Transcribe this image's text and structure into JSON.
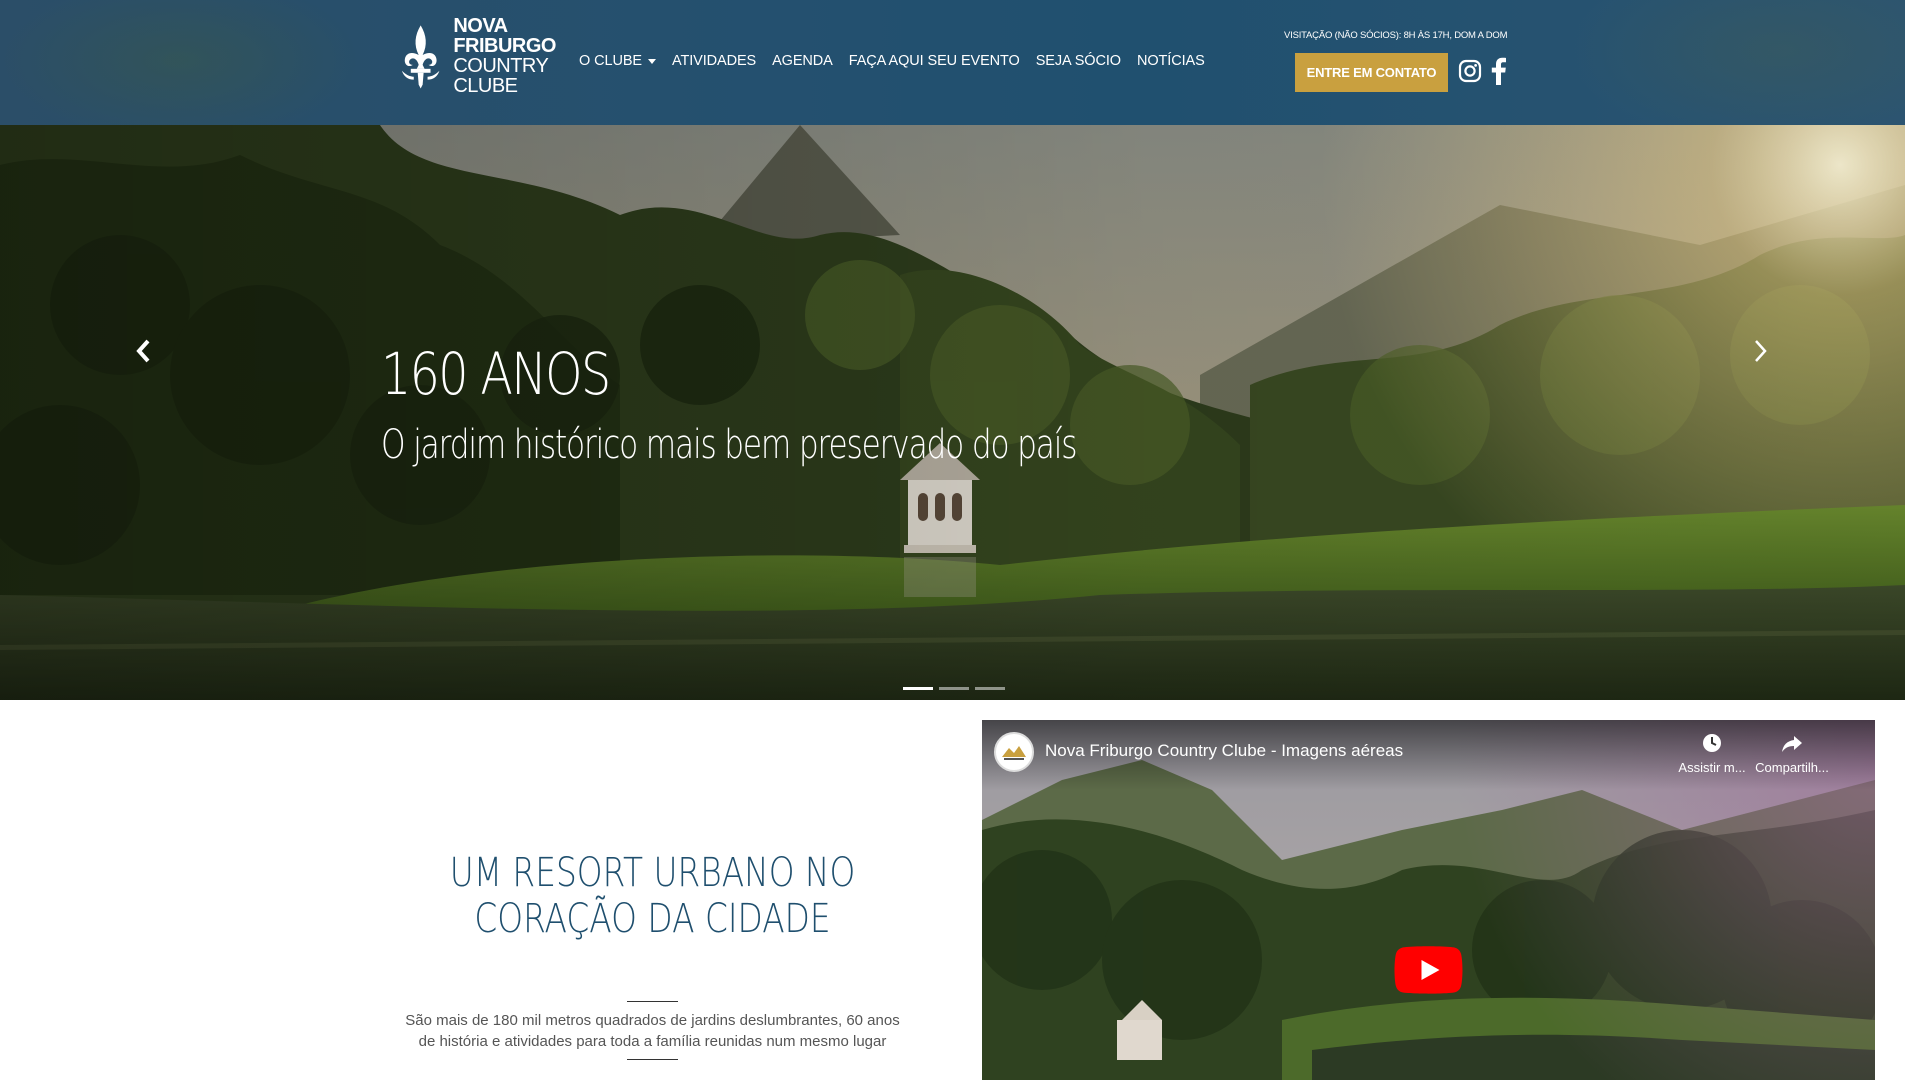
{
  "header": {
    "logo": {
      "line1": "NOVA",
      "line2": "FRIBURGO",
      "line3": "COUNTRY",
      "line4": "CLUBE"
    },
    "nav": [
      {
        "label": "O CLUBE",
        "dropdown": true
      },
      {
        "label": "ATIVIDADES"
      },
      {
        "label": "AGENDA"
      },
      {
        "label": "FAÇA AQUI SEU EVENTO"
      },
      {
        "label": "SEJA SÓCIO"
      },
      {
        "label": "NOTÍCIAS"
      }
    ],
    "visit_note": "VISITAÇÃO (NÃO SÓCIOS): 8H ÀS 17H, DOM A DOM",
    "contact_button": "ENTRE EM CONTATO",
    "social": {
      "instagram": "instagram-icon",
      "facebook": "facebook-icon"
    },
    "colors": {
      "header_bg": "#24506f",
      "button_bg": "#c9a03f"
    }
  },
  "hero": {
    "title": "160 ANOS",
    "subtitle": "O jardim histórico mais bem preservado do país",
    "slides": 3,
    "active_slide": 0
  },
  "resort": {
    "title_line1": "UM RESORT URBANO NO",
    "title_line2": "CORAÇÃO DA CIDADE",
    "description_line1": "São mais de 180 mil metros quadrados de jardins deslumbrantes, 60 anos",
    "description_line2": "de história e atividades para toda a família reunidas num mesmo lugar",
    "title_color": "#1f4f6e"
  },
  "video": {
    "title": "Nova Friburgo Country Clube - Imagens aéreas",
    "watch_later_label": "Assistir m...",
    "share_label": "Compartilh..."
  }
}
